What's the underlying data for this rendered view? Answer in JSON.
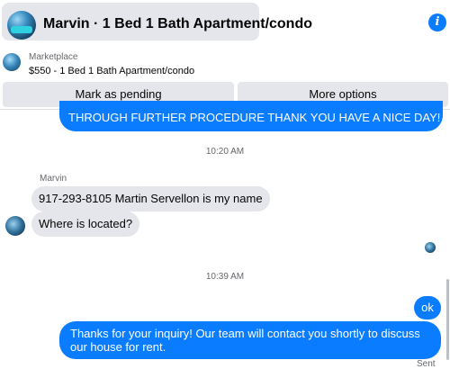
{
  "header": {
    "title": "Marvin · 1 Bed 1 Bath Apartment/condo",
    "avatar_icon": "profile-avatar-icon",
    "info_icon": "info-icon",
    "info_glyph": "i"
  },
  "listing": {
    "label": "Marketplace",
    "price_title": "$550 - 1 Bed 1 Bath Apartment/condo",
    "thumb_icon": "listing-thumbnail"
  },
  "actions": {
    "mark_pending": "Mark as pending",
    "more_options": "More options"
  },
  "conversation": {
    "previous_outgoing": "THROUGH FURTHER PROCEDURE THANK YOU HAVE A NICE DAY!",
    "timestamp_1": "10:20 AM",
    "sender_name": "Marvin",
    "incoming_1": "917-293-8105 Martin Servellon is my name",
    "incoming_2": "Where is located?",
    "timestamp_2": "10:39 AM",
    "outgoing_1": "ok",
    "outgoing_2": "Thanks for your inquiry! Our team will contact you shortly to discuss our house for rent.",
    "status": "Sent"
  },
  "colors": {
    "outgoing_bubble": "#0a7cff",
    "incoming_bubble": "#e4e6eb",
    "button_bg": "#e4e6eb",
    "muted_text": "#65676b"
  }
}
